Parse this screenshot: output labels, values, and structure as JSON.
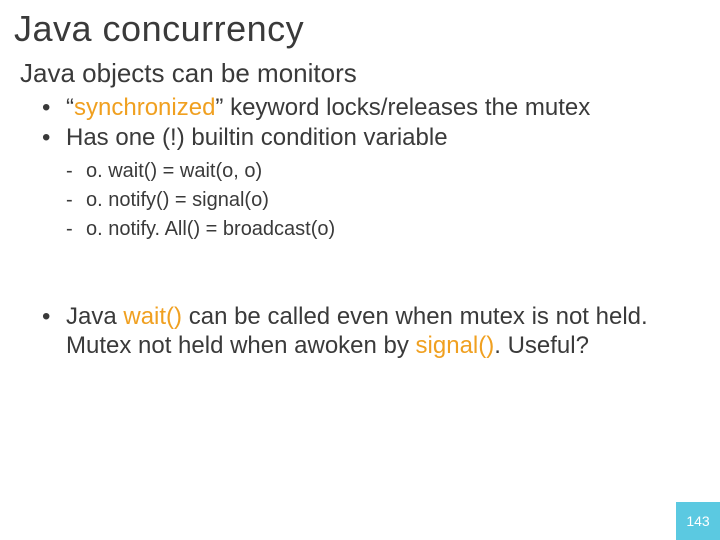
{
  "title": "Java concurrency",
  "subtitle": "Java objects can be monitors",
  "bullets_top": {
    "b0_pre": "“",
    "b0_kw": "synchronized",
    "b0_post": "” keyword locks/releases the mutex",
    "b1": "Has one (!) builtin condition variable"
  },
  "dashes": {
    "d0": "o. wait() = wait(o, o)",
    "d1": "o. notify() = signal(o)",
    "d2": "o. notify. All() = broadcast(o)"
  },
  "bullets_bottom": {
    "p0": "Java ",
    "p1_kw": "wait()",
    "p2": " can be called even when mutex is not held. Mutex not held when awoken by ",
    "p3_kw": "signal()",
    "p4": ". Useful?"
  },
  "page_number": "143"
}
